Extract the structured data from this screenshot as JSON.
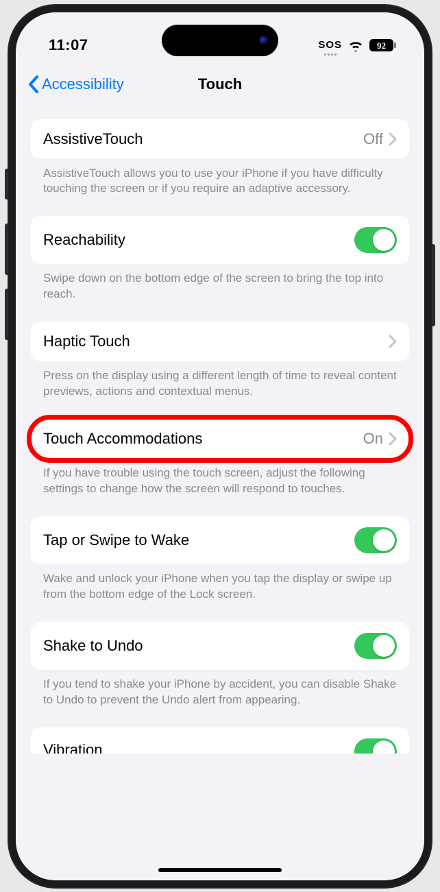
{
  "status": {
    "time": "11:07",
    "sos": "SOS",
    "battery": "92"
  },
  "nav": {
    "back": "Accessibility",
    "title": "Touch"
  },
  "groups": [
    {
      "label": "AssistiveTouch",
      "type": "link",
      "value": "Off",
      "footer": "AssistiveTouch allows you to use your iPhone if you have difficulty touching the screen or if you require an adaptive accessory.",
      "highlighted": false
    },
    {
      "label": "Reachability",
      "type": "toggle",
      "on": true,
      "footer": "Swipe down on the bottom edge of the screen to bring the top into reach.",
      "highlighted": false
    },
    {
      "label": "Haptic Touch",
      "type": "link",
      "value": "",
      "footer": "Press on the display using a different length of time to reveal content previews, actions and contextual menus.",
      "highlighted": false
    },
    {
      "label": "Touch Accommodations",
      "type": "link",
      "value": "On",
      "footer": "If you have trouble using the touch screen, adjust the following settings to change how the screen will respond to touches.",
      "highlighted": true
    },
    {
      "label": "Tap or Swipe to Wake",
      "type": "toggle",
      "on": true,
      "footer": "Wake and unlock your iPhone when you tap the display or swipe up from the bottom edge of the Lock screen.",
      "highlighted": false
    },
    {
      "label": "Shake to Undo",
      "type": "toggle",
      "on": true,
      "footer": "If you tend to shake your iPhone by accident, you can disable Shake to Undo to prevent the Undo alert from appearing.",
      "highlighted": false
    }
  ],
  "partial": {
    "label": "Vibration",
    "on": true
  }
}
